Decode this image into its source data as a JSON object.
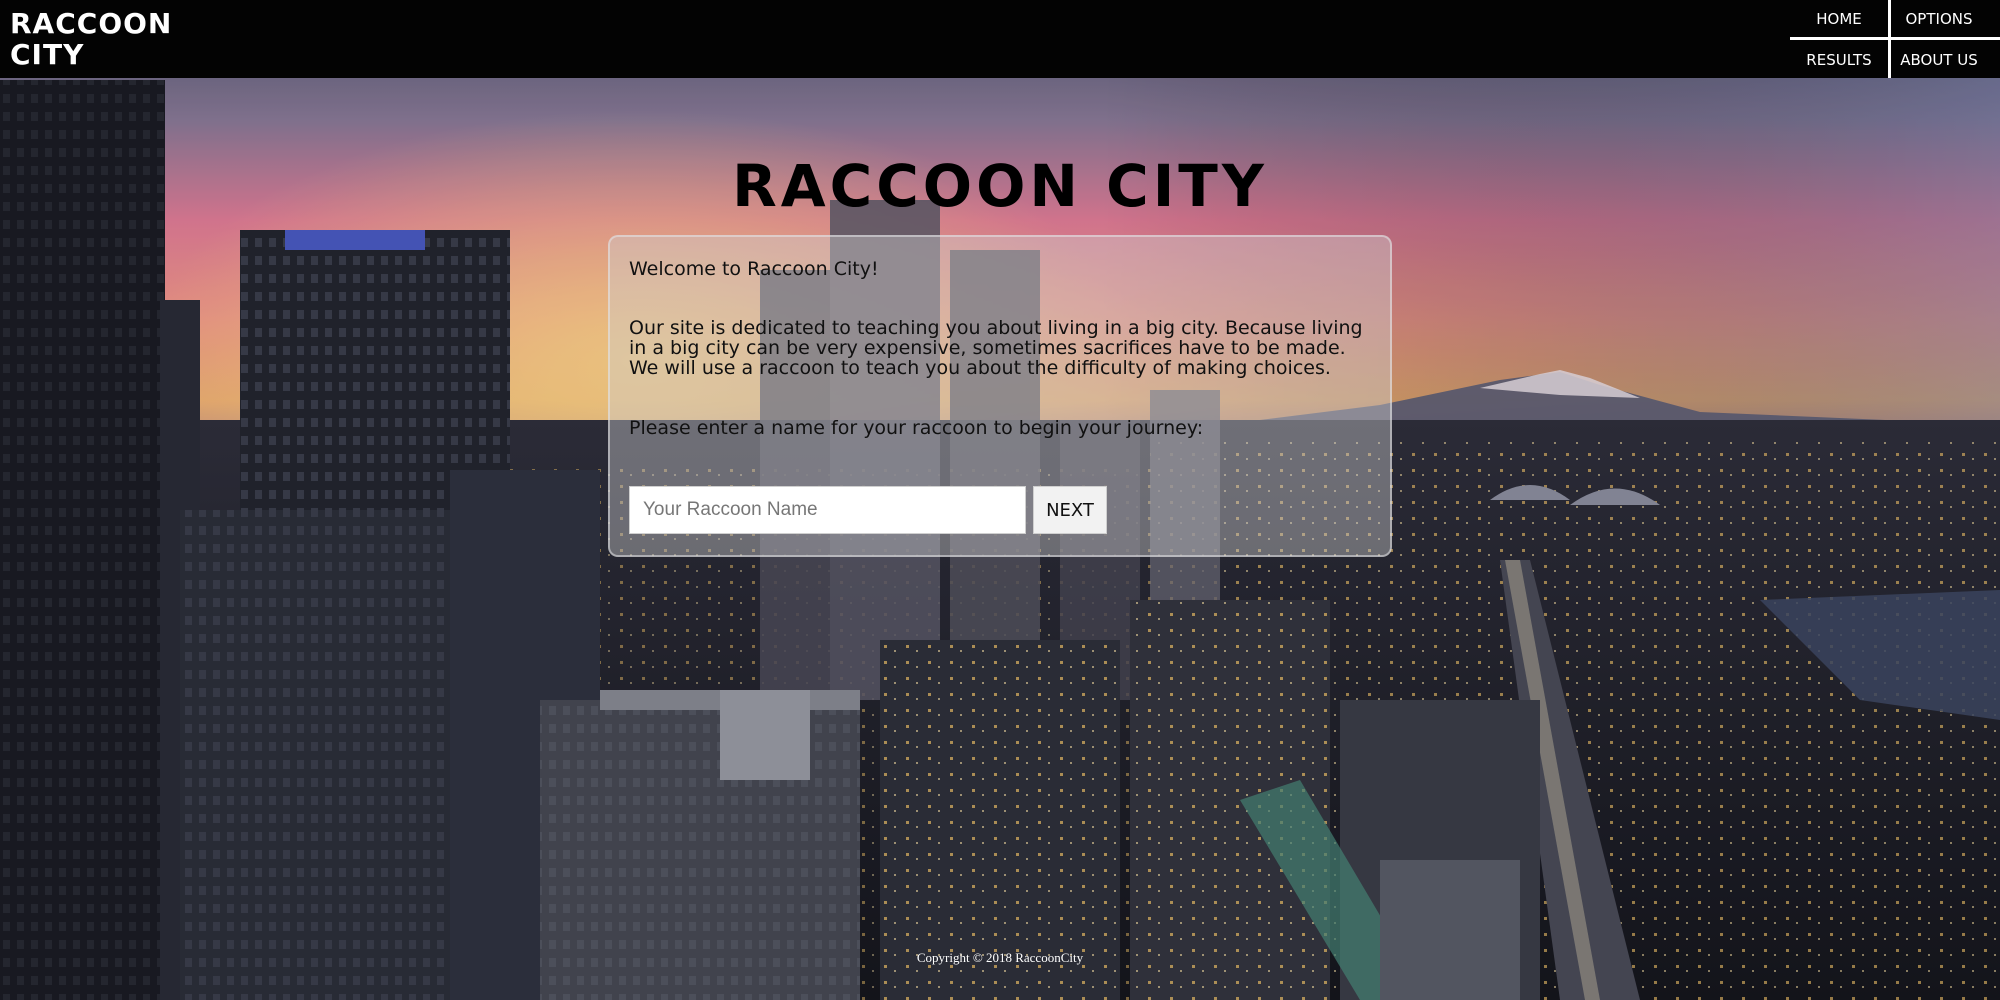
{
  "header": {
    "logo_text": "RACCOON CITY",
    "nav": {
      "home": "HOME",
      "options": "OPTIONS",
      "results": "RESULTS",
      "about": "ABOUT US"
    }
  },
  "main": {
    "title": "RACCOON CITY",
    "welcome": "Welcome to Raccoon City!",
    "description": "Our site is dedicated to teaching you about living in a big city. Because living in a big city can be very expensive, sometimes sacrifices have to be made. We will use a raccoon to teach you about the difficulty of making choices.",
    "prompt": "Please enter a name for your raccoon to begin your journey:",
    "name_input": {
      "placeholder": "Your Raccoon Name",
      "value": ""
    },
    "next_label": "NEXT"
  },
  "footer": {
    "copyright": "Copyright © 2018 RaccoonCity"
  },
  "colors": {
    "header_bg": "#030303",
    "sky_top": "#5a5f7a",
    "sky_pink": "#f08aa0",
    "sky_orange": "#f6b06a",
    "card_bg": "rgba(205,205,208,0.42)"
  },
  "background": {
    "description_icon": "city-skyline-sunset-image"
  }
}
